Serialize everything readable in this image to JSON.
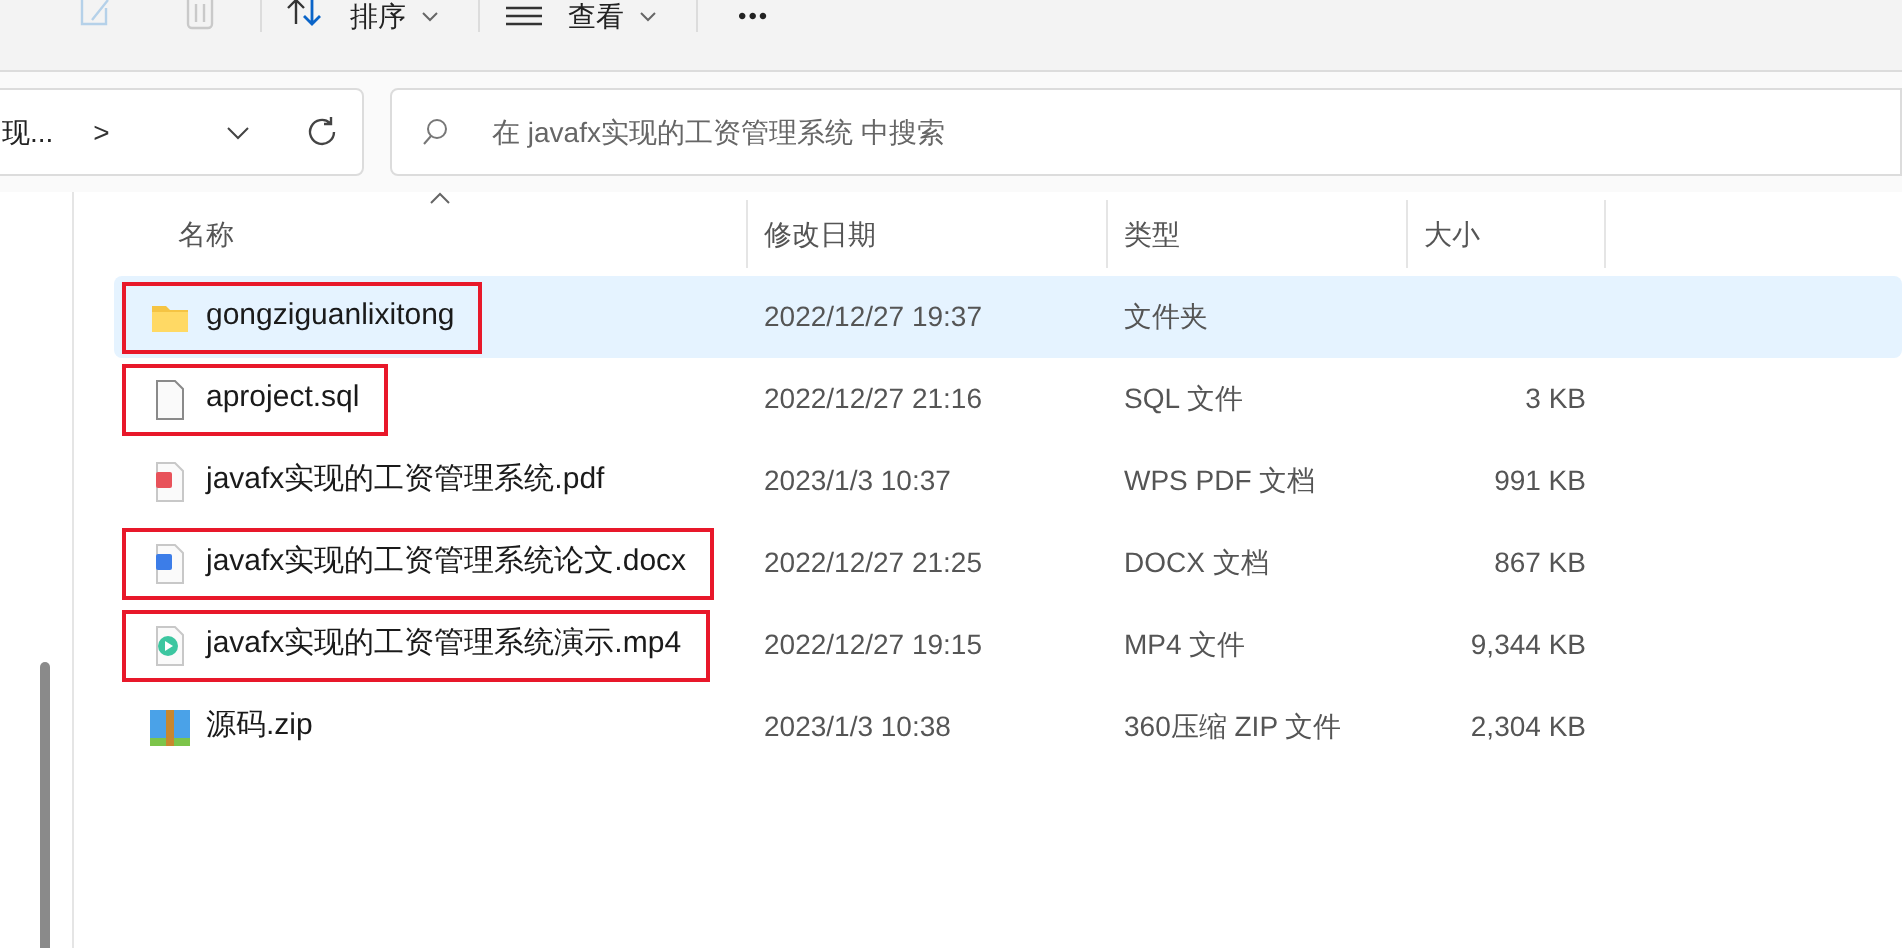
{
  "toolbar": {
    "items": [
      {
        "kind": "rename",
        "disabled": true
      },
      {
        "kind": "delete",
        "disabled": true
      },
      {
        "kind": "sort",
        "label": "排序"
      },
      {
        "kind": "view",
        "label": "查看"
      },
      {
        "kind": "more",
        "label": "•••"
      }
    ]
  },
  "address_bar": {
    "path": "现...",
    "separator": ">"
  },
  "search": {
    "placeholder": "在 javafx实现的工资管理系统 中搜索"
  },
  "table": {
    "columns": [
      {
        "label": "名称",
        "sorted": true
      },
      {
        "label": "修改日期",
        "sorted": false
      },
      {
        "label": "类型",
        "sorted": false
      },
      {
        "label": "大小",
        "sorted": false
      }
    ],
    "rows": [
      {
        "kind": "folder",
        "name": "gongziguanlixitong",
        "date": "2022/12/27 19:37",
        "type": "文件夹",
        "selected": true,
        "annotated": true
      },
      {
        "kind": "file",
        "name": "aproject.sql",
        "date": "2022/12/27 21:16",
        "type": "SQL 文件",
        "size": "3 KB",
        "selected": false,
        "annotated": true
      },
      {
        "kind": "pdf",
        "name": "javafx实现的工资管理系统.pdf",
        "date": "2023/1/3 10:37",
        "type": "WPS PDF 文档",
        "size": "991 KB",
        "selected": false,
        "annotated": false
      },
      {
        "kind": "docx",
        "name": "javafx实现的工资管理系统论文.docx",
        "date": "2022/12/27 21:25",
        "type": "DOCX 文档",
        "size": "867 KB",
        "selected": false,
        "annotated": true
      },
      {
        "kind": "video",
        "name": "javafx实现的工资管理系统演示.mp4",
        "date": "2022/12/27 19:15",
        "type": "MP4 文件",
        "size": "9,344 KB",
        "selected": false,
        "annotated": true
      },
      {
        "kind": "zip",
        "name": "源码.zip",
        "date": "2023/1/3 10:38",
        "type": "360压缩 ZIP 文件",
        "size": "2,304 KB",
        "selected": false,
        "annotated": false
      }
    ]
  }
}
